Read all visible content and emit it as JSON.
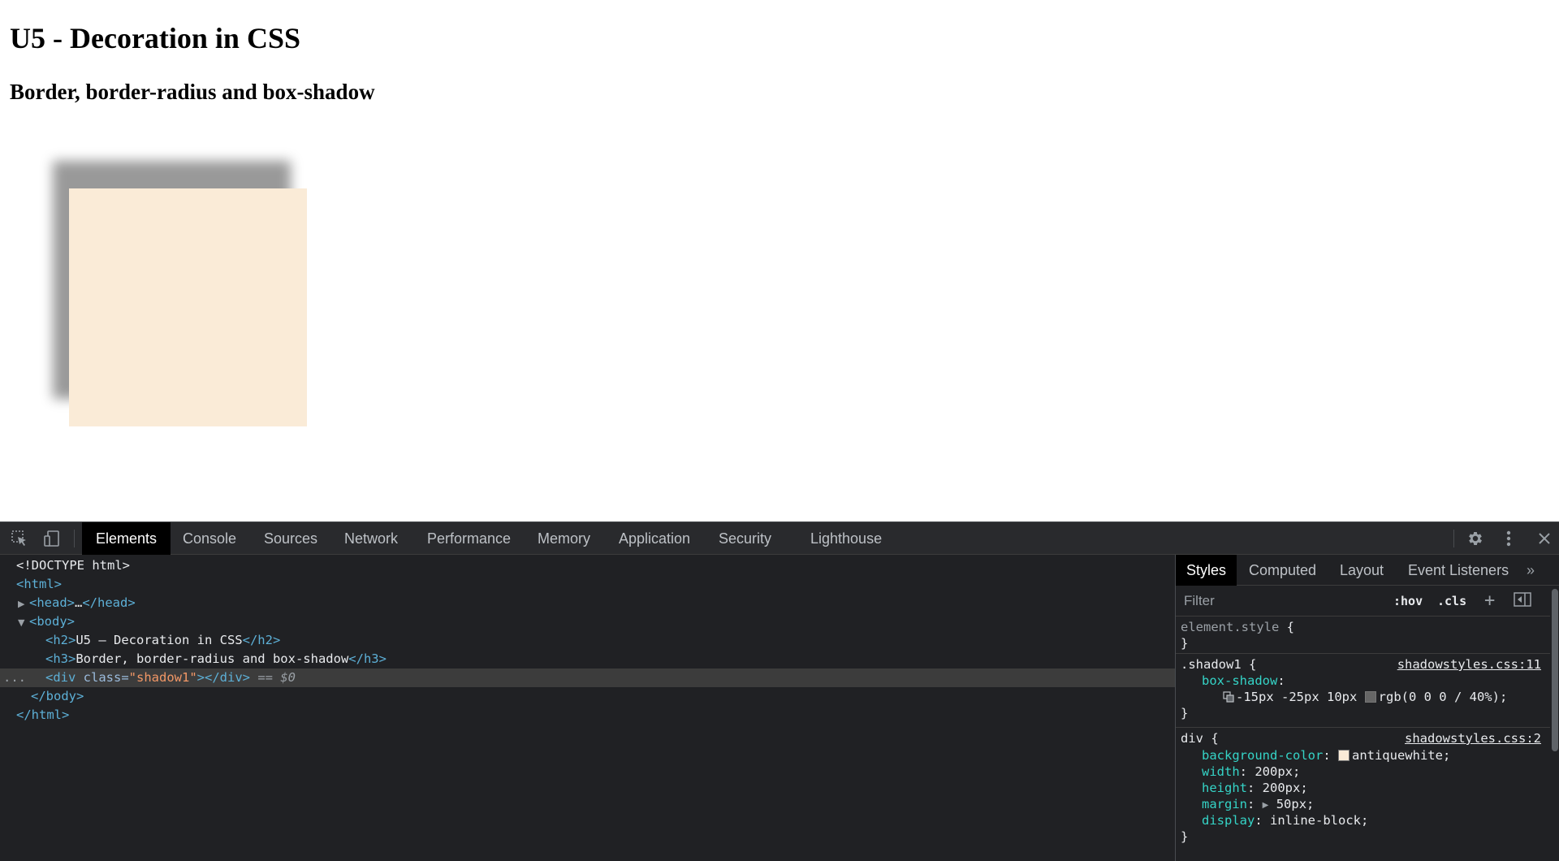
{
  "page": {
    "h2": "U5 - Decoration in CSS",
    "h3": "Border, border-radius and box-shadow",
    "box_color": "#faebd7"
  },
  "devtools": {
    "toolbar_icons": [
      "inspect-element-icon",
      "device-toolbar-icon",
      "settings-icon",
      "more-options-icon",
      "close-icon"
    ],
    "tabs": [
      "Elements",
      "Console",
      "Sources",
      "Network",
      "Performance",
      "Memory",
      "Application",
      "Security",
      "Lighthouse"
    ],
    "active_tab": "Elements",
    "dom": {
      "doctype": "<!DOCTYPE html>",
      "html_open": "<html>",
      "head_open": "<head>",
      "head_ellipsis": "…",
      "head_close": "</head>",
      "body_open": "<body>",
      "h2_open": "<h2>",
      "h2_text": "U5 – Decoration in CSS",
      "h2_close": "</h2>",
      "h3_open": "<h3>",
      "h3_text": "Border, border-radius and box-shadow",
      "h3_close": "</h3>",
      "div_open": "<div ",
      "div_attr_name": "class=",
      "div_attr_value": "\"shadow1\"",
      "div_rest": "></div>",
      "selected_marker": "== $0",
      "gutter_dots": "...",
      "body_close": "</body>",
      "html_close": "</html>"
    },
    "sidebar": {
      "tabs": [
        "Styles",
        "Computed",
        "Layout",
        "Event Listeners"
      ],
      "more": "»",
      "filter_placeholder": "Filter",
      "hov": ":hov",
      "cls": ".cls",
      "add": "+",
      "element_style": "element.style",
      "open_brace": "{",
      "close_brace": "}",
      "rule1": {
        "selector": ".shadow1",
        "source": "shadowstyles.css:11",
        "prop": "box-shadow",
        "value_offsets": "-15px -25px 10px",
        "value_color": "rgb(0 0 0 / 40%);",
        "swatch_color": "#666666"
      },
      "rule2": {
        "selector": "div",
        "source": "shadowstyles.css:2",
        "props": [
          {
            "name": "background-color",
            "value": "antiquewhite;",
            "swatch": "#faebd7"
          },
          {
            "name": "width",
            "value": "200px;"
          },
          {
            "name": "height",
            "value": "200px;"
          },
          {
            "name": "margin",
            "value": "50px;"
          },
          {
            "name": "display",
            "value": "inline-block;"
          }
        ]
      }
    }
  }
}
